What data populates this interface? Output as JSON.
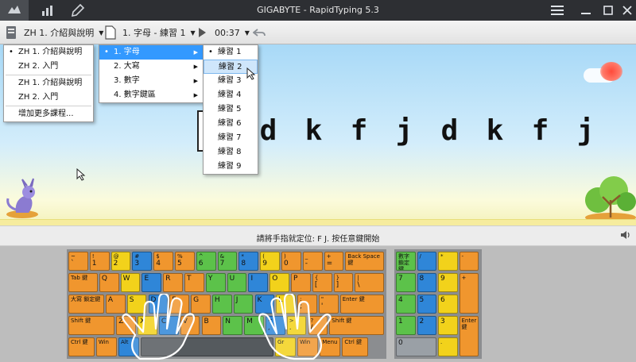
{
  "window": {
    "title": "GIGABYTE - RapidTyping 5.3",
    "nav_icons": [
      "keyboard-icon",
      "chart-icon",
      "brush-icon"
    ],
    "controls": [
      "hamburger-icon",
      "minimize-icon",
      "maximize-icon",
      "close-icon"
    ]
  },
  "toolbar": {
    "course": "ZH 1. 介紹與說明",
    "lesson": "1. 字母 - 練習 1",
    "time": "00:37"
  },
  "menus": {
    "course_items": [
      {
        "label": "ZH 1. 介紹與說明",
        "checked": true
      },
      {
        "label": "ZH 2. 入門",
        "checked": false
      }
    ],
    "course_items_2": [
      {
        "label": "ZH 1. 介紹與說明"
      },
      {
        "label": "ZH 2. 入門"
      }
    ],
    "add_more": "增加更多課程...",
    "sections": [
      {
        "label": "1. 字母",
        "highlighted": true
      },
      {
        "label": "2. 大寫"
      },
      {
        "label": "3. 數字"
      },
      {
        "label": "4. 數字鍵區"
      }
    ],
    "exercises": [
      "練習 1",
      "練習 2",
      "練習 3",
      "練習 4",
      "練習 5",
      "練習 6",
      "練習 7",
      "練習 8",
      "練習 9"
    ],
    "exercise_checked": 0,
    "exercise_hover": 1
  },
  "stage": {
    "letters": [
      "j",
      "d",
      "k",
      "f",
      "j",
      "d",
      "k",
      "f",
      "j"
    ]
  },
  "status": {
    "message": "請將手指就定位: F J. 按任意鍵開始"
  },
  "colors": {
    "orange": "#f0962e",
    "yellow": "#f2d21b",
    "green": "#5cc24a",
    "blue": "#2f86d8",
    "highlight": "#3399ff"
  },
  "keyboard": {
    "rows": [
      [
        {
          "t": "~",
          "b": "`",
          "c": "or"
        },
        {
          "t": "!",
          "b": "1",
          "c": "or"
        },
        {
          "t": "@",
          "b": "2",
          "c": "ye"
        },
        {
          "t": "#",
          "b": "3",
          "c": "bl"
        },
        {
          "t": "$",
          "b": "4",
          "c": "or"
        },
        {
          "t": "%",
          "b": "5",
          "c": "or"
        },
        {
          "t": "^",
          "b": "6",
          "c": "gr"
        },
        {
          "t": "&",
          "b": "7",
          "c": "gr"
        },
        {
          "t": "*",
          "b": "8",
          "c": "bl"
        },
        {
          "t": "(",
          "b": "9",
          "c": "ye"
        },
        {
          "t": ")",
          "b": "0",
          "c": "or"
        },
        {
          "t": "_",
          "b": "-",
          "c": "or"
        },
        {
          "t": "+",
          "b": "=",
          "c": "or"
        },
        {
          "t": "Back Space 鍵",
          "b": "",
          "c": "or",
          "w": 1.9
        }
      ],
      [
        {
          "t": "Tab 鍵",
          "b": "",
          "c": "or",
          "w": 1.45
        },
        {
          "t": "",
          "b": "Q",
          "c": "or"
        },
        {
          "t": "",
          "b": "W",
          "c": "ye"
        },
        {
          "t": "",
          "b": "E",
          "c": "bl"
        },
        {
          "t": "",
          "b": "R",
          "c": "or"
        },
        {
          "t": "",
          "b": "T",
          "c": "or"
        },
        {
          "t": "",
          "b": "Y",
          "c": "gr"
        },
        {
          "t": "",
          "b": "U",
          "c": "gr"
        },
        {
          "t": "",
          "b": "I",
          "c": "bl"
        },
        {
          "t": "",
          "b": "O",
          "c": "ye"
        },
        {
          "t": "",
          "b": "P",
          "c": "or"
        },
        {
          "t": "{",
          "b": "[",
          "c": "or"
        },
        {
          "t": "}",
          "b": "]",
          "c": "or"
        },
        {
          "t": "|",
          "b": "\\",
          "c": "or",
          "w": 1.45
        }
      ],
      [
        {
          "t": "大寫 鎖定鍵",
          "b": "",
          "c": "or",
          "w": 1.75
        },
        {
          "t": "",
          "b": "A",
          "c": "or"
        },
        {
          "t": "",
          "b": "S",
          "c": "ye"
        },
        {
          "t": "",
          "b": "D",
          "c": "bl"
        },
        {
          "t": "",
          "b": "F",
          "c": "or"
        },
        {
          "t": "",
          "b": "G",
          "c": "or"
        },
        {
          "t": "",
          "b": "H",
          "c": "gr"
        },
        {
          "t": "",
          "b": "J",
          "c": "gr"
        },
        {
          "t": "",
          "b": "K",
          "c": "bl"
        },
        {
          "t": "",
          "b": "L",
          "c": "ye"
        },
        {
          "t": ":",
          "b": ";",
          "c": "or"
        },
        {
          "t": "\"",
          "b": "'",
          "c": "or"
        },
        {
          "t": "Enter 鍵",
          "b": "",
          "c": "or",
          "w": 2.15
        }
      ],
      [
        {
          "t": "Shift 鍵",
          "b": "",
          "c": "or",
          "w": 2.25
        },
        {
          "t": "",
          "b": "Z",
          "c": "or"
        },
        {
          "t": "",
          "b": "X",
          "c": "ye"
        },
        {
          "t": "",
          "b": "C",
          "c": "bl"
        },
        {
          "t": "",
          "b": "V",
          "c": "or"
        },
        {
          "t": "",
          "b": "B",
          "c": "or"
        },
        {
          "t": "",
          "b": "N",
          "c": "gr"
        },
        {
          "t": "",
          "b": "M",
          "c": "gr"
        },
        {
          "t": "<",
          "b": ",",
          "c": "bl"
        },
        {
          "t": ">",
          "b": ".",
          "c": "ye"
        },
        {
          "t": "?",
          "b": "/",
          "c": "or"
        },
        {
          "t": "Shift 鍵",
          "b": "",
          "c": "or",
          "w": 2.65
        }
      ],
      [
        {
          "t": "Ctrl 鍵",
          "b": "",
          "c": "or",
          "w": 1.3
        },
        {
          "t": "Win",
          "b": "",
          "c": "or",
          "w": 1.05
        },
        {
          "t": "Alt",
          "b": "",
          "c": "bl",
          "w": 1.05
        },
        {
          "t": "",
          "b": "",
          "c": "sp",
          "w": 6.3
        },
        {
          "t": "Gr",
          "b": "",
          "c": "ye",
          "w": 1.05
        },
        {
          "t": "Win",
          "b": "",
          "c": "or",
          "w": 1.05
        },
        {
          "t": "Menu",
          "b": "",
          "c": "or",
          "w": 1.05
        },
        {
          "t": "Ctrl 鍵",
          "b": "",
          "c": "or",
          "w": 1.3
        }
      ]
    ],
    "numpad": [
      {
        "t": "數字 鎖定鍵",
        "b": "",
        "c": "gr",
        "col": 0,
        "row": 0
      },
      {
        "t": "/",
        "b": "",
        "c": "bl",
        "col": 1,
        "row": 0
      },
      {
        "t": "*",
        "b": "",
        "c": "ye",
        "col": 2,
        "row": 0
      },
      {
        "t": "-",
        "b": "",
        "c": "or",
        "col": 3,
        "row": 0
      },
      {
        "t": "",
        "b": "7",
        "c": "gr",
        "col": 0,
        "row": 1
      },
      {
        "t": "",
        "b": "8",
        "c": "bl",
        "col": 1,
        "row": 1
      },
      {
        "t": "",
        "b": "9",
        "c": "ye",
        "col": 2,
        "row": 1
      },
      {
        "t": "+",
        "b": "",
        "c": "or",
        "col": 3,
        "row": 1,
        "h": 2
      },
      {
        "t": "",
        "b": "4",
        "c": "gr",
        "col": 0,
        "row": 2
      },
      {
        "t": "",
        "b": "5",
        "c": "bl",
        "col": 1,
        "row": 2
      },
      {
        "t": "",
        "b": "6",
        "c": "ye",
        "col": 2,
        "row": 2
      },
      {
        "t": "",
        "b": "1",
        "c": "gr",
        "col": 0,
        "row": 3
      },
      {
        "t": "",
        "b": "2",
        "c": "bl",
        "col": 1,
        "row": 3
      },
      {
        "t": "",
        "b": "3",
        "c": "ye",
        "col": 2,
        "row": 3
      },
      {
        "t": "Enter 鍵",
        "b": "",
        "c": "or",
        "col": 3,
        "row": 3,
        "h": 2
      },
      {
        "t": "",
        "b": "0",
        "c": "gy",
        "col": 0,
        "row": 4,
        "w": 2
      },
      {
        "t": ".",
        "b": "",
        "c": "ye",
        "col": 2,
        "row": 4
      }
    ]
  }
}
